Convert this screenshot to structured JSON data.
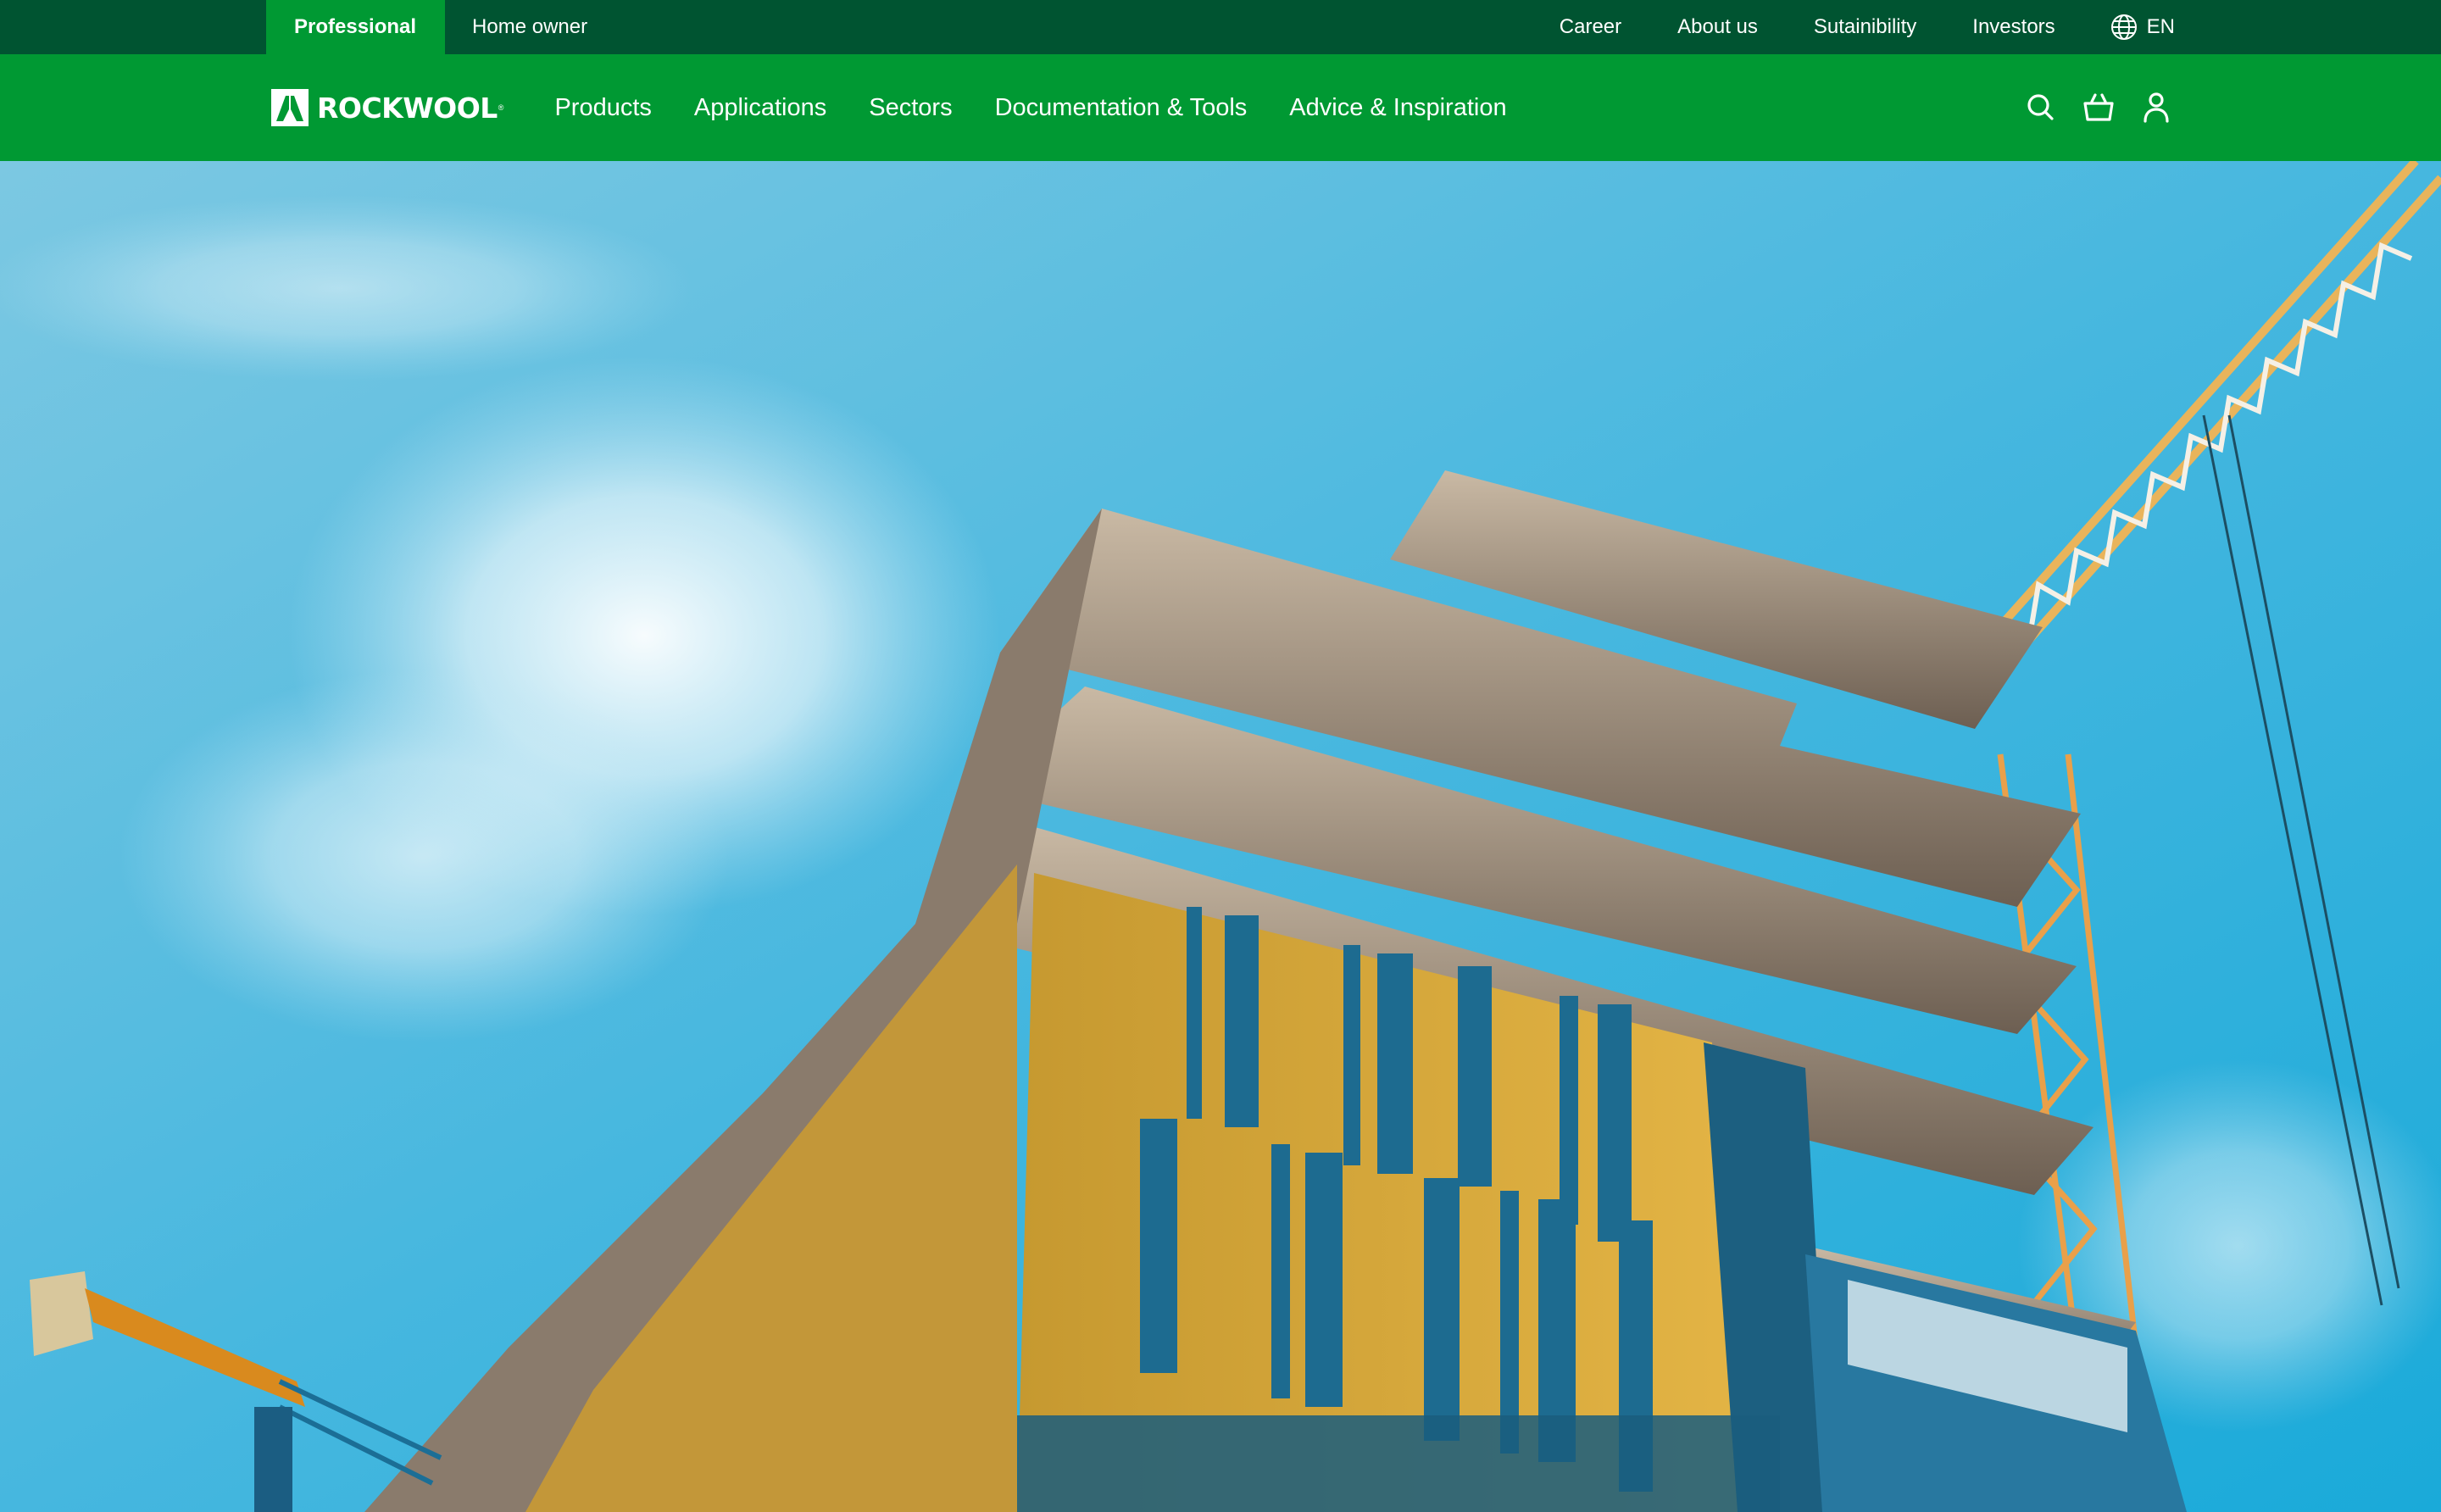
{
  "topbar": {
    "segments": [
      {
        "label": "Professional",
        "active": true
      },
      {
        "label": "Home owner",
        "active": false
      }
    ],
    "links": [
      "Career",
      "About us",
      "Sutainibility",
      "Investors"
    ],
    "language": {
      "icon": "globe-icon",
      "label": "EN"
    }
  },
  "nav": {
    "logo": {
      "text": "ROCKWOOL",
      "registered": "®"
    },
    "items": [
      "Products",
      "Applications",
      "Sectors",
      "Documentation & Tools",
      "Advice & Inspiration"
    ],
    "icons": [
      "search-icon",
      "basket-icon",
      "user-icon"
    ]
  },
  "hero": {
    "image_description": "Building under construction with yellow facade panels and blue glass windows against blue sky, tower cranes on left and right",
    "colors": {
      "sky": "#3fb6de",
      "facade": "#d9a93a",
      "glass": "#1d6f95",
      "concrete": "#9b8a78"
    }
  },
  "colors": {
    "topbar": "#005431",
    "nav": "#009933",
    "active_tab": "#009933",
    "text": "#ffffff"
  }
}
